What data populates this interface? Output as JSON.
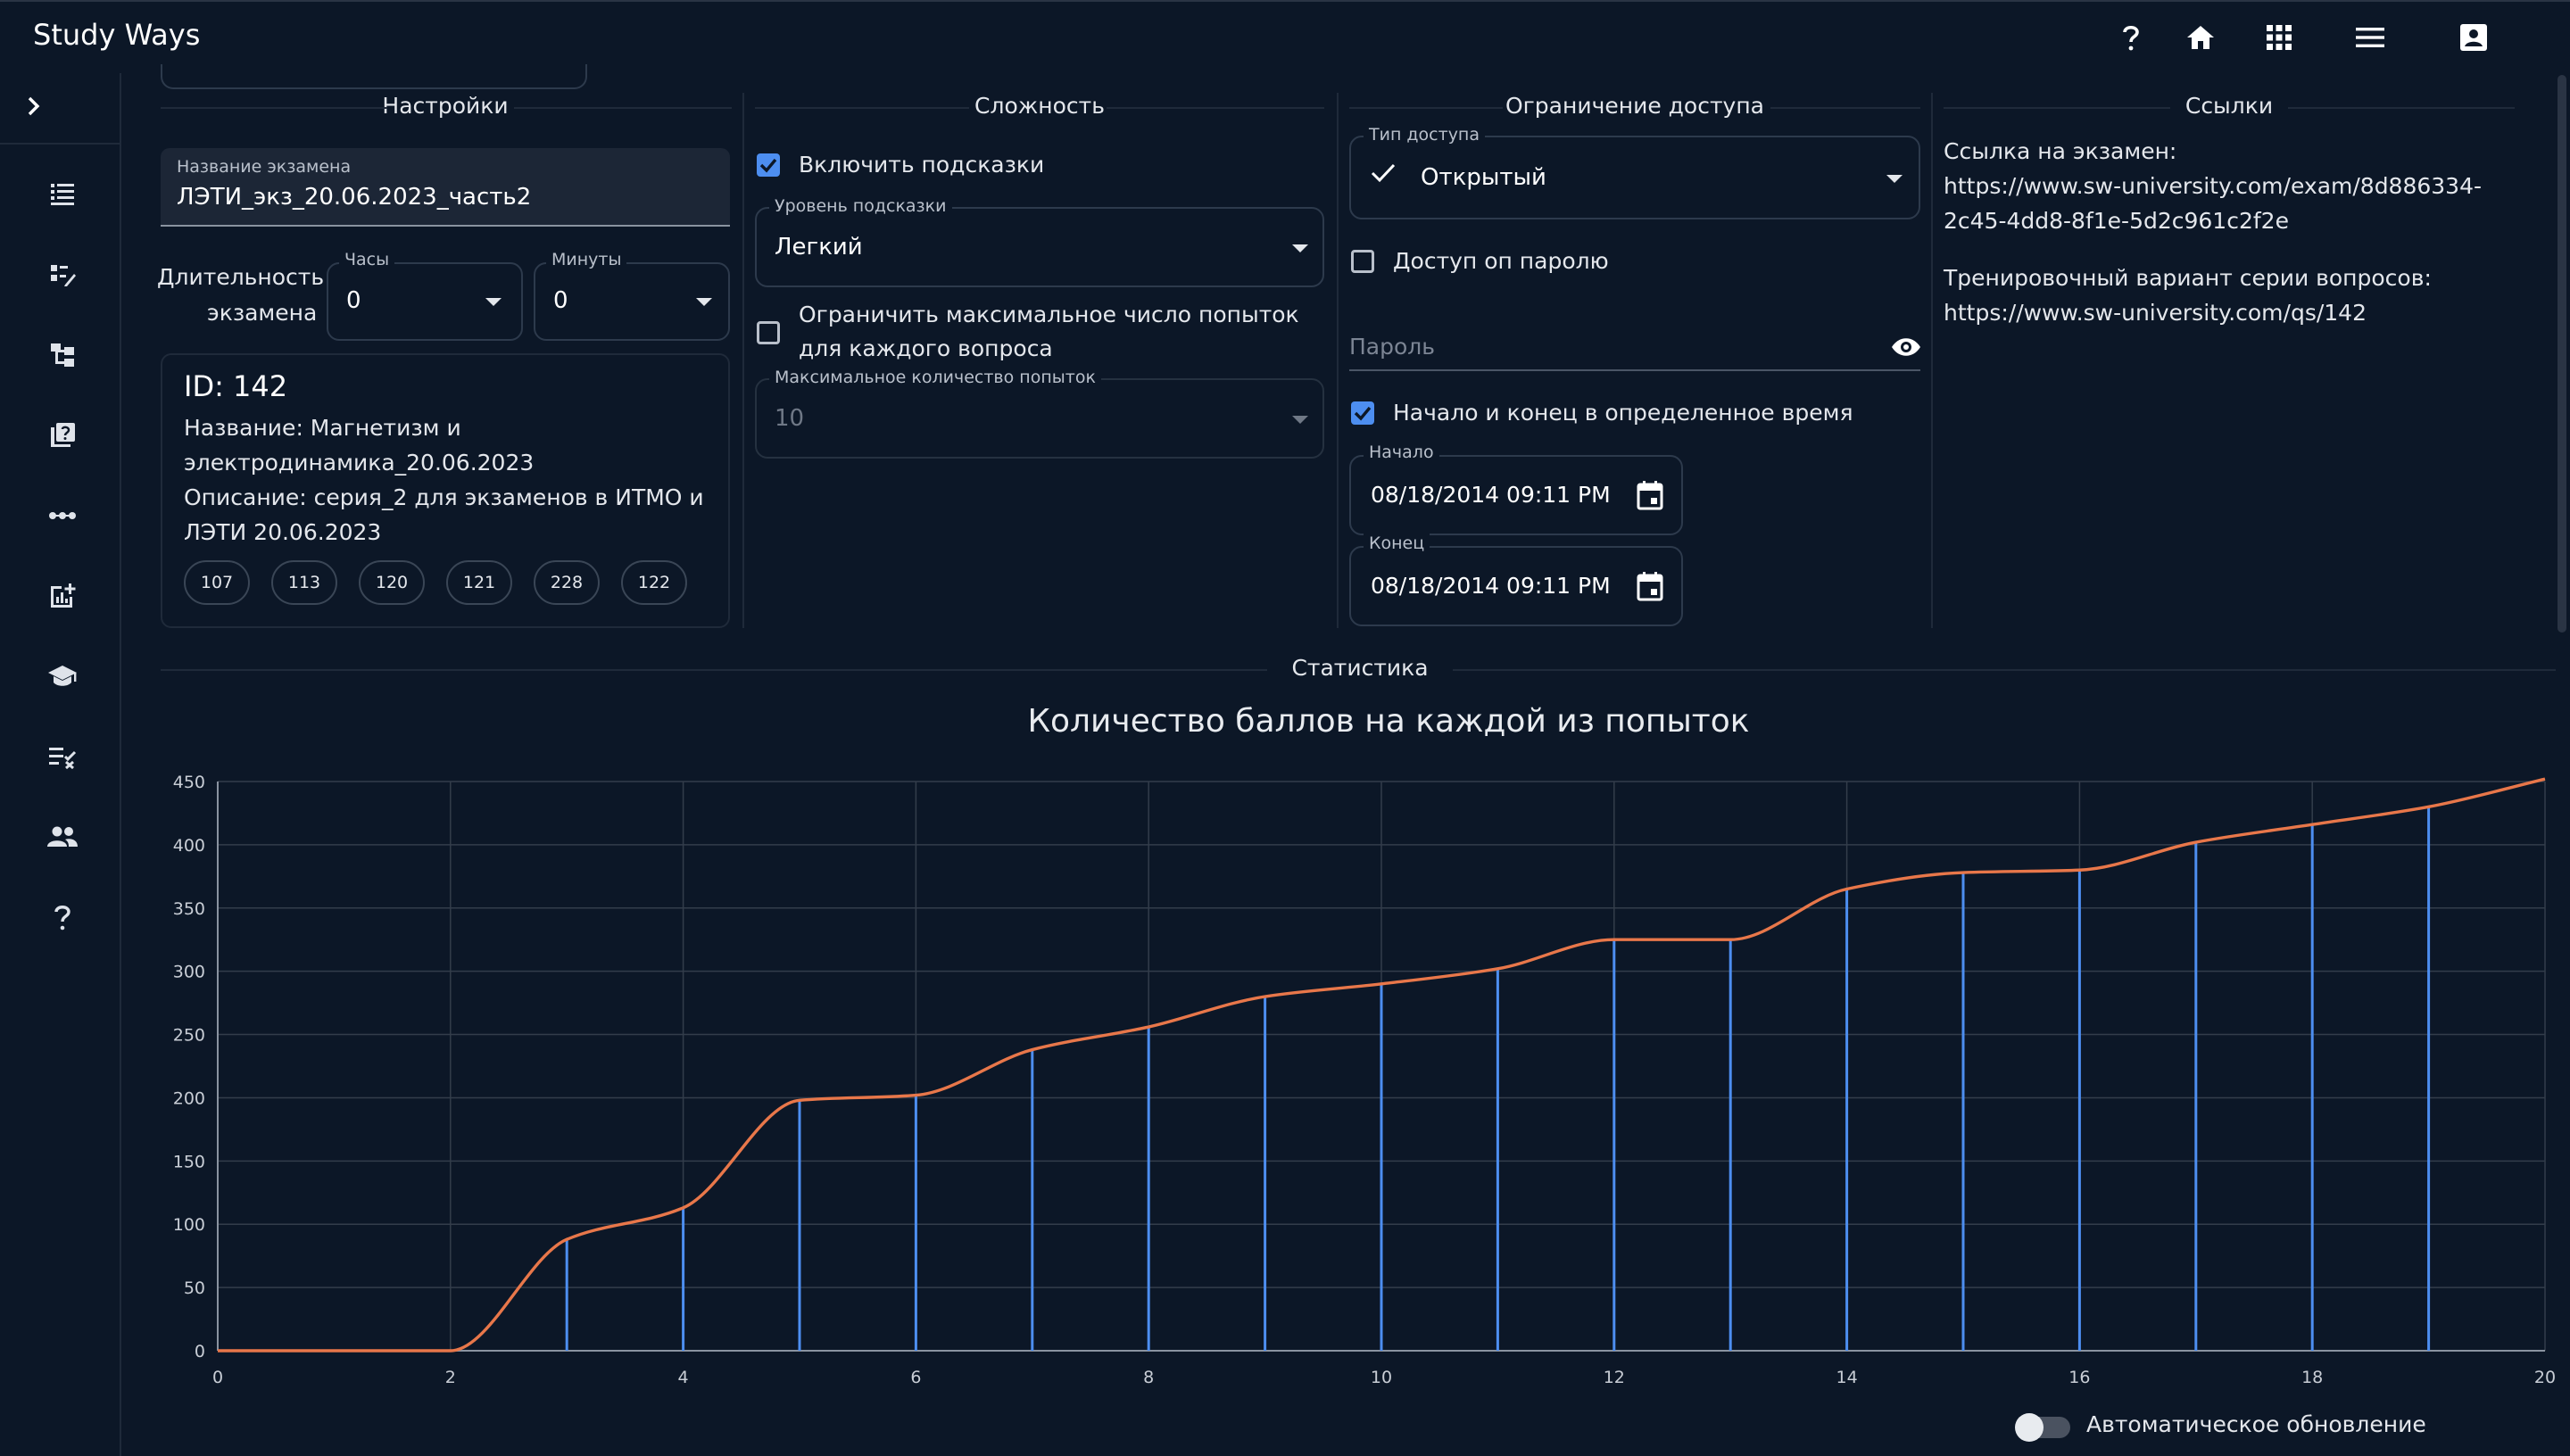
{
  "app": {
    "title": "Study Ways"
  },
  "topbar": {
    "icons": [
      "help-icon",
      "home-icon",
      "apps-grid-icon",
      "menu-icon",
      "account-box-icon"
    ]
  },
  "sidebar": {
    "icons": [
      "expand-chevron-icon",
      "list-icon",
      "edit-grid-icon",
      "tree-icon",
      "question-library-icon",
      "dots-line-icon",
      "add-chart-icon",
      "school-icon",
      "checklist-icon",
      "people-icon",
      "help-icon"
    ]
  },
  "settings": {
    "title": "Настройки",
    "exam_name_label": "Название экзамена",
    "exam_name_value": "ЛЭТИ_экз_20.06.2023_часть2",
    "duration_label_1": "Длительность",
    "duration_label_2": "экзамена",
    "hours_label": "Часы",
    "hours_value": "0",
    "minutes_label": "Минуты",
    "minutes_value": "0",
    "id_text": "ID: 142",
    "name_line_1": "Название: Магнетизм и",
    "name_line_2": "электродинамика_20.06.2023",
    "desc_line_1": "Описание: серия_2 для экзаменов в ИТМО и",
    "desc_line_2": "ЛЭТИ 20.06.2023",
    "chips": [
      "107",
      "113",
      "120",
      "121",
      "228",
      "122"
    ]
  },
  "difficulty": {
    "title": "Сложность",
    "hints_label": "Включить подсказки",
    "hints_checked": true,
    "hint_level_label": "Уровень подсказки",
    "hint_level_value": "Легкий",
    "limit_label_1": "Ограничить максимальное число попыток",
    "limit_label_2": "для каждого вопроса",
    "limit_checked": false,
    "max_attempts_label": "Максимальное количество попыток",
    "max_attempts_value": "10"
  },
  "access": {
    "title": "Ограничение доступа",
    "type_label": "Тип доступа",
    "type_value": "Открытый",
    "password_access_label": "Доступ оп паролю",
    "password_access_checked": false,
    "password_placeholder": "Пароль",
    "timed_label": "Начало и конец в определенное время",
    "timed_checked": true,
    "start_label": "Начало",
    "start_value": "08/18/2014 09:11 PM",
    "end_label": "Конец",
    "end_value": "08/18/2014 09:11 PM"
  },
  "links": {
    "title": "Ссылки",
    "exam_link_label": "Ссылка на экзамен:",
    "exam_link_line_1": "https://www.sw-university.com/exam/8d886334-",
    "exam_link_line_2": "2c45-4dd8-8f1e-5d2c961c2f2e",
    "training_label": "Тренировочный вариант серии вопросов:",
    "training_link": "https://www.sw-university.com/qs/142"
  },
  "stats": {
    "title": "Статистика",
    "auto_update_label": "Автоматическое обновление",
    "auto_update_on": false
  },
  "colors": {
    "line": "#e8774a",
    "bars": "#4d8ef0",
    "accent": "#4d8ef0",
    "background": "#0c1727"
  },
  "chart_data": {
    "type": "line",
    "title": "Количество баллов на каждой из попыток",
    "x": [
      0,
      1,
      2,
      3,
      4,
      5,
      6,
      7,
      8,
      9,
      10,
      11,
      12,
      13,
      14,
      15,
      16,
      17,
      18,
      19,
      20
    ],
    "series": [
      {
        "values": [
          0,
          0,
          0,
          88,
          113,
          198,
          202,
          238,
          256,
          280,
          290,
          302,
          325,
          325,
          365,
          378,
          380,
          402,
          416,
          430,
          452
        ]
      }
    ],
    "bars_at": [
      3,
      4,
      5,
      6,
      7,
      8,
      9,
      10,
      11,
      12,
      13,
      14,
      15,
      16,
      17,
      18,
      19
    ],
    "xlim": [
      0,
      20
    ],
    "ylim": [
      0,
      450
    ],
    "xticks": [
      0,
      2,
      4,
      6,
      8,
      10,
      12,
      14,
      16,
      18,
      20
    ],
    "yticks": [
      0,
      50,
      100,
      150,
      200,
      250,
      300,
      350,
      400,
      450
    ],
    "grid": true
  }
}
